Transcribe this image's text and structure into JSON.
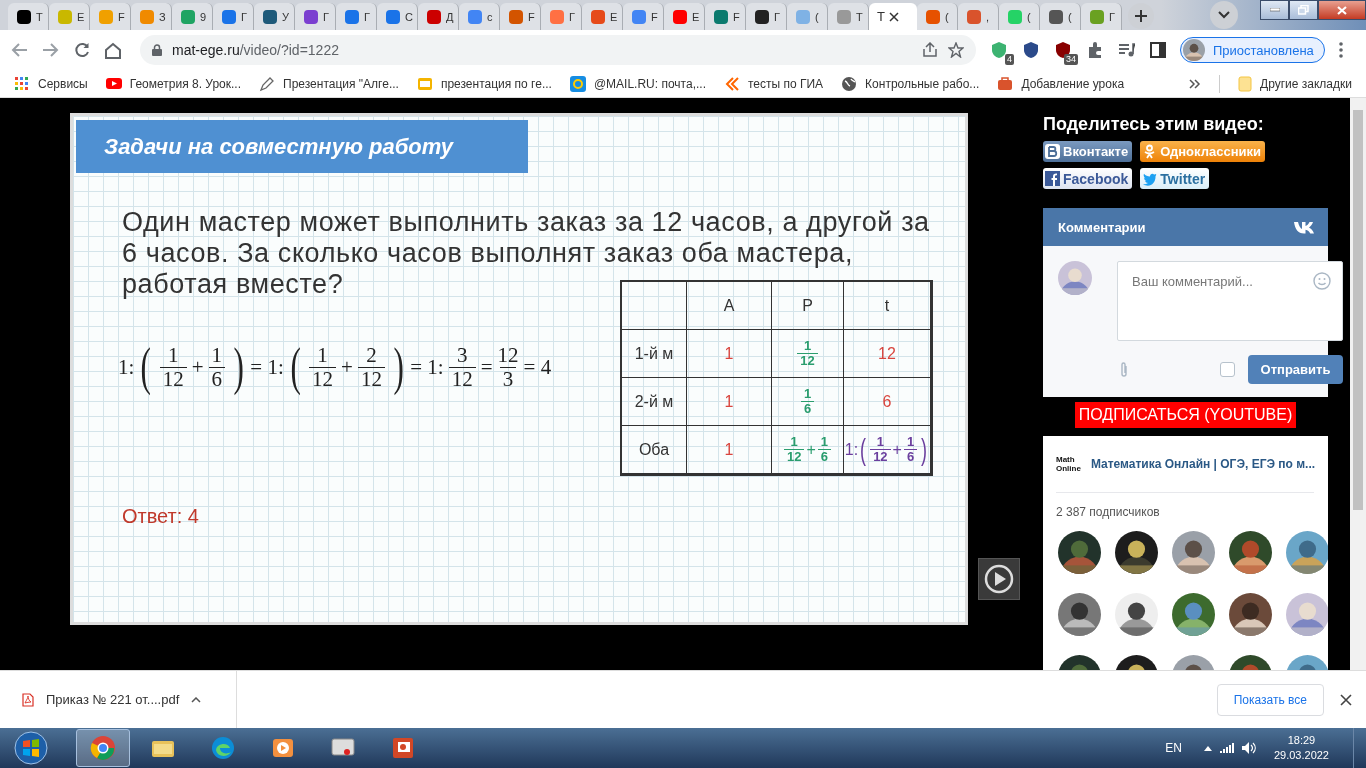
{
  "browser": {
    "tabs": [
      {
        "label": "Т",
        "selected": false
      },
      {
        "label": "Е",
        "selected": false
      },
      {
        "label": "F",
        "selected": false
      },
      {
        "label": "З",
        "selected": false
      },
      {
        "label": "9",
        "selected": false
      },
      {
        "label": "Г",
        "selected": false
      },
      {
        "label": "У",
        "selected": false
      },
      {
        "label": "Г",
        "selected": false
      },
      {
        "label": "Г",
        "selected": false
      },
      {
        "label": "С",
        "selected": false
      },
      {
        "label": "Д",
        "selected": false
      },
      {
        "label": "с",
        "selected": false
      },
      {
        "label": "F",
        "selected": false
      },
      {
        "label": "Г",
        "selected": false
      },
      {
        "label": "Е",
        "selected": false
      },
      {
        "label": "F",
        "selected": false
      },
      {
        "label": "Е",
        "selected": false
      },
      {
        "label": "F",
        "selected": false
      },
      {
        "label": "Г",
        "selected": false
      },
      {
        "label": "(",
        "selected": false
      },
      {
        "label": "Т",
        "selected": false
      },
      {
        "label": "Т",
        "selected": true
      },
      {
        "label": "(",
        "selected": false
      },
      {
        "label": ",",
        "selected": false
      },
      {
        "label": "(",
        "selected": false
      },
      {
        "label": "(",
        "selected": false
      },
      {
        "label": "Г",
        "selected": false
      }
    ],
    "address": {
      "host": "mat-ege.ru",
      "path": "/video/?id=1222"
    },
    "extension_badges": [
      "4",
      "34"
    ],
    "profile": "Приостановлена",
    "bookmarks": [
      {
        "label": "Сервисы"
      },
      {
        "label": "Геометрия 8. Урок..."
      },
      {
        "label": "Презентация \"Алге..."
      },
      {
        "label": "презентация по ге..."
      },
      {
        "label": "@MAIL.RU: почта,..."
      },
      {
        "label": "тесты по ГИА"
      },
      {
        "label": "Контрольные рабо..."
      },
      {
        "label": "Добавление урока"
      }
    ],
    "other_bookmarks": "Другие закладки"
  },
  "slide": {
    "title": "Задачи на совместную работу",
    "question": "Один мастер может выполнить заказ за 12 часов, а другой за 6 часов. За сколько часов выполнят заказ оба мастера, работая вместе?",
    "formula": [
      {
        "kind": "text",
        "text": "1:"
      },
      {
        "kind": "paren",
        "text": "("
      },
      {
        "kind": "frac",
        "num": "1",
        "den": "12"
      },
      {
        "kind": "text",
        "text": "+"
      },
      {
        "kind": "frac",
        "num": "1",
        "den": "6"
      },
      {
        "kind": "paren",
        "text": ")"
      },
      {
        "kind": "text",
        "text": "= 1:"
      },
      {
        "kind": "paren",
        "text": "("
      },
      {
        "kind": "frac",
        "num": "1",
        "den": "12"
      },
      {
        "kind": "text",
        "text": "+"
      },
      {
        "kind": "frac",
        "num": "2",
        "den": "12"
      },
      {
        "kind": "paren",
        "text": ")"
      },
      {
        "kind": "text",
        "text": "= 1:"
      },
      {
        "kind": "frac",
        "num": "3",
        "den": "12"
      },
      {
        "kind": "text",
        "text": "="
      },
      {
        "kind": "frac",
        "num": "12",
        "den": "3"
      },
      {
        "kind": "text",
        "text": "= 4"
      }
    ],
    "table": {
      "columns": [
        "A",
        "P",
        "t"
      ],
      "rows": [
        {
          "label": "1-й м",
          "cells": [
            {
              "color": "#d9453e",
              "parts": [
                {
                  "kind": "text",
                  "text": "1"
                }
              ]
            },
            {
              "color": "#2a9d6e",
              "parts": [
                {
                  "kind": "frac",
                  "num": "1",
                  "den": "12"
                }
              ]
            },
            {
              "color": "#d9453e",
              "parts": [
                {
                  "kind": "text",
                  "text": "12"
                }
              ]
            }
          ]
        },
        {
          "label": "2-й м",
          "cells": [
            {
              "color": "#d9453e",
              "parts": [
                {
                  "kind": "text",
                  "text": "1"
                }
              ]
            },
            {
              "color": "#2a9d6e",
              "parts": [
                {
                  "kind": "frac",
                  "num": "1",
                  "den": "6"
                }
              ]
            },
            {
              "color": "#d9453e",
              "parts": [
                {
                  "kind": "text",
                  "text": "6"
                }
              ]
            }
          ]
        },
        {
          "label": "Оба",
          "cells": [
            {
              "color": "#d9453e",
              "parts": [
                {
                  "kind": "text",
                  "text": "1"
                }
              ]
            },
            {
              "color": "#2a9d6e",
              "parts": [
                {
                  "kind": "frac",
                  "num": "1",
                  "den": "12"
                },
                {
                  "kind": "text",
                  "text": "+"
                },
                {
                  "kind": "frac",
                  "num": "1",
                  "den": "6"
                }
              ]
            },
            {
              "color": "#6b3f9e",
              "parts": [
                {
                  "kind": "text",
                  "text": "1:"
                },
                {
                  "kind": "paren",
                  "text": "("
                },
                {
                  "kind": "frac",
                  "num": "1",
                  "den": "12"
                },
                {
                  "kind": "text",
                  "text": "+"
                },
                {
                  "kind": "frac",
                  "num": "1",
                  "den": "6"
                },
                {
                  "kind": "paren",
                  "text": ")"
                }
              ]
            }
          ]
        }
      ]
    },
    "answer": "Ответ: 4"
  },
  "share": {
    "heading": "Поделитесь этим видео:",
    "buttons": [
      {
        "kind": "vk",
        "label": "Вконтакте"
      },
      {
        "kind": "ok",
        "label": "Одноклассники"
      },
      {
        "kind": "facebook",
        "label": "Facebook"
      },
      {
        "kind": "twitter",
        "label": "Twitter"
      }
    ]
  },
  "comments": {
    "title": "Комментарии",
    "placeholder": "Ваш комментарий...",
    "checked": false,
    "submit": "Отправить"
  },
  "subscribe": "ПОДПИСАТЬСЯ (YOUTUBE)",
  "group": {
    "logo": [
      "Math",
      "Online"
    ],
    "name": "Математика Онлайн | ОГЭ, ЕГЭ по м...",
    "subscribers": "2 387 подписчиков",
    "members": [
      {
        "kind": "picture"
      },
      {
        "kind": "picture"
      },
      {
        "kind": "picture"
      },
      {
        "kind": "picture"
      },
      {
        "kind": "picture"
      },
      {
        "kind": "picture"
      },
      {
        "kind": "picture"
      },
      {
        "kind": "picture"
      },
      {
        "kind": "picture"
      },
      {
        "kind": "picture"
      },
      {
        "kind": "picture"
      },
      {
        "kind": "picture"
      },
      {
        "kind": "picture"
      },
      {
        "kind": "picture"
      },
      {
        "kind": "picture"
      }
    ]
  },
  "downloads": {
    "file": "Приказ № 221 от....pdf",
    "show_all": "Показать все"
  },
  "taskbar": {
    "apps": [
      {
        "selected": true
      },
      {
        "selected": false
      },
      {
        "selected": false
      },
      {
        "selected": false
      },
      {
        "selected": false
      },
      {
        "selected": false
      }
    ],
    "language": "EN",
    "time": "18:29",
    "date": "29.03.2022"
  }
}
